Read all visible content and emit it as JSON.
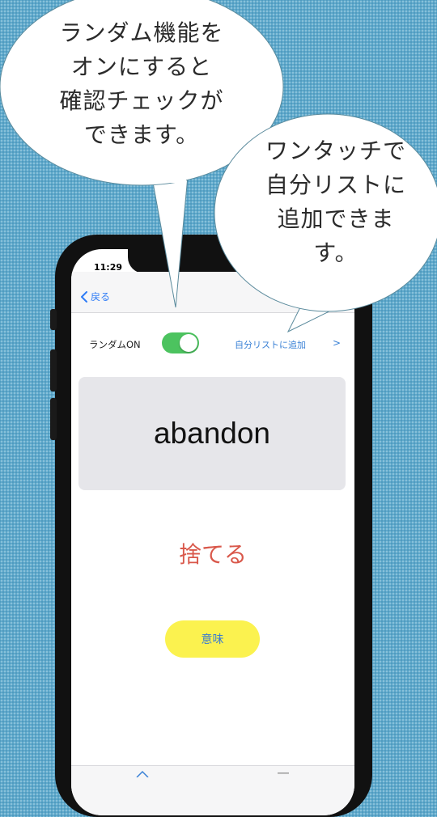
{
  "status_bar": {
    "time": "11:29"
  },
  "nav": {
    "back_label": "戻る"
  },
  "controls": {
    "random_label": "ランダムON",
    "random_on": true,
    "add_to_list_label": "自分リストに追加",
    "add_chevron": ">"
  },
  "card": {
    "word": "abandon",
    "meaning": "捨てる"
  },
  "meaning_button": {
    "label": "意味"
  },
  "callouts": {
    "left": [
      "ランダム機能を",
      "オンにすると",
      "確認チェックが",
      "できます。"
    ],
    "right": [
      "ワンタッチで",
      "自分リストに",
      "追加できま",
      "す。"
    ]
  },
  "colors": {
    "background": "#5ea9cc",
    "toggle_on": "#4cc35f",
    "link_blue": "#3b82d6",
    "meaning_red": "#d9584b",
    "button_yellow": "#fbf24f"
  }
}
